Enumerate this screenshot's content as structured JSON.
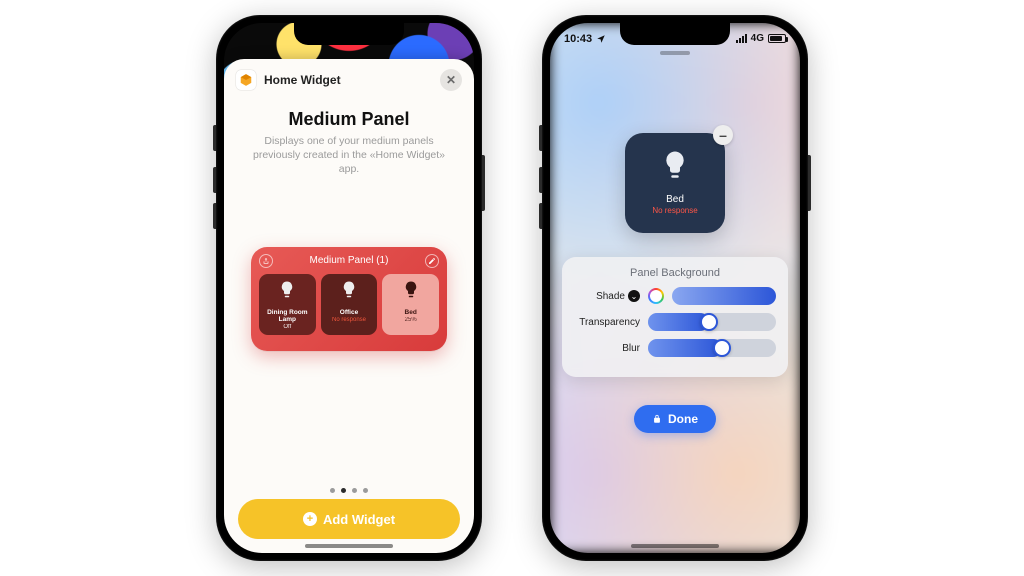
{
  "phoneA": {
    "app_name": "Home Widget",
    "heading": "Medium Panel",
    "subtext": "Displays one of your medium panels previously created in the «Home Widget» app.",
    "widget": {
      "title": "Medium Panel (1)",
      "tiles": [
        {
          "name": "Dining Room Lamp",
          "status": "Off"
        },
        {
          "name": "Office",
          "status": "No response"
        },
        {
          "name": "Bed",
          "status": "25%"
        }
      ]
    },
    "page_dots": {
      "count": 4,
      "active": 1
    },
    "add_button": "Add Widget"
  },
  "phoneB": {
    "status": {
      "time": "10:43",
      "network": "4G"
    },
    "card": {
      "name": "Bed",
      "status": "No response"
    },
    "panel": {
      "title": "Panel Background",
      "rows": {
        "shade": {
          "label": "Shade"
        },
        "transparency": {
          "label": "Transparency",
          "value_pct": 48
        },
        "blur": {
          "label": "Blur",
          "value_pct": 58
        }
      }
    },
    "done": "Done"
  },
  "colors": {
    "accent_yellow": "#f6c328",
    "accent_blue": "#2f6df0",
    "widget_red": "#d83b3b",
    "card_navy": "#25344d",
    "error_red": "#ff5646"
  }
}
